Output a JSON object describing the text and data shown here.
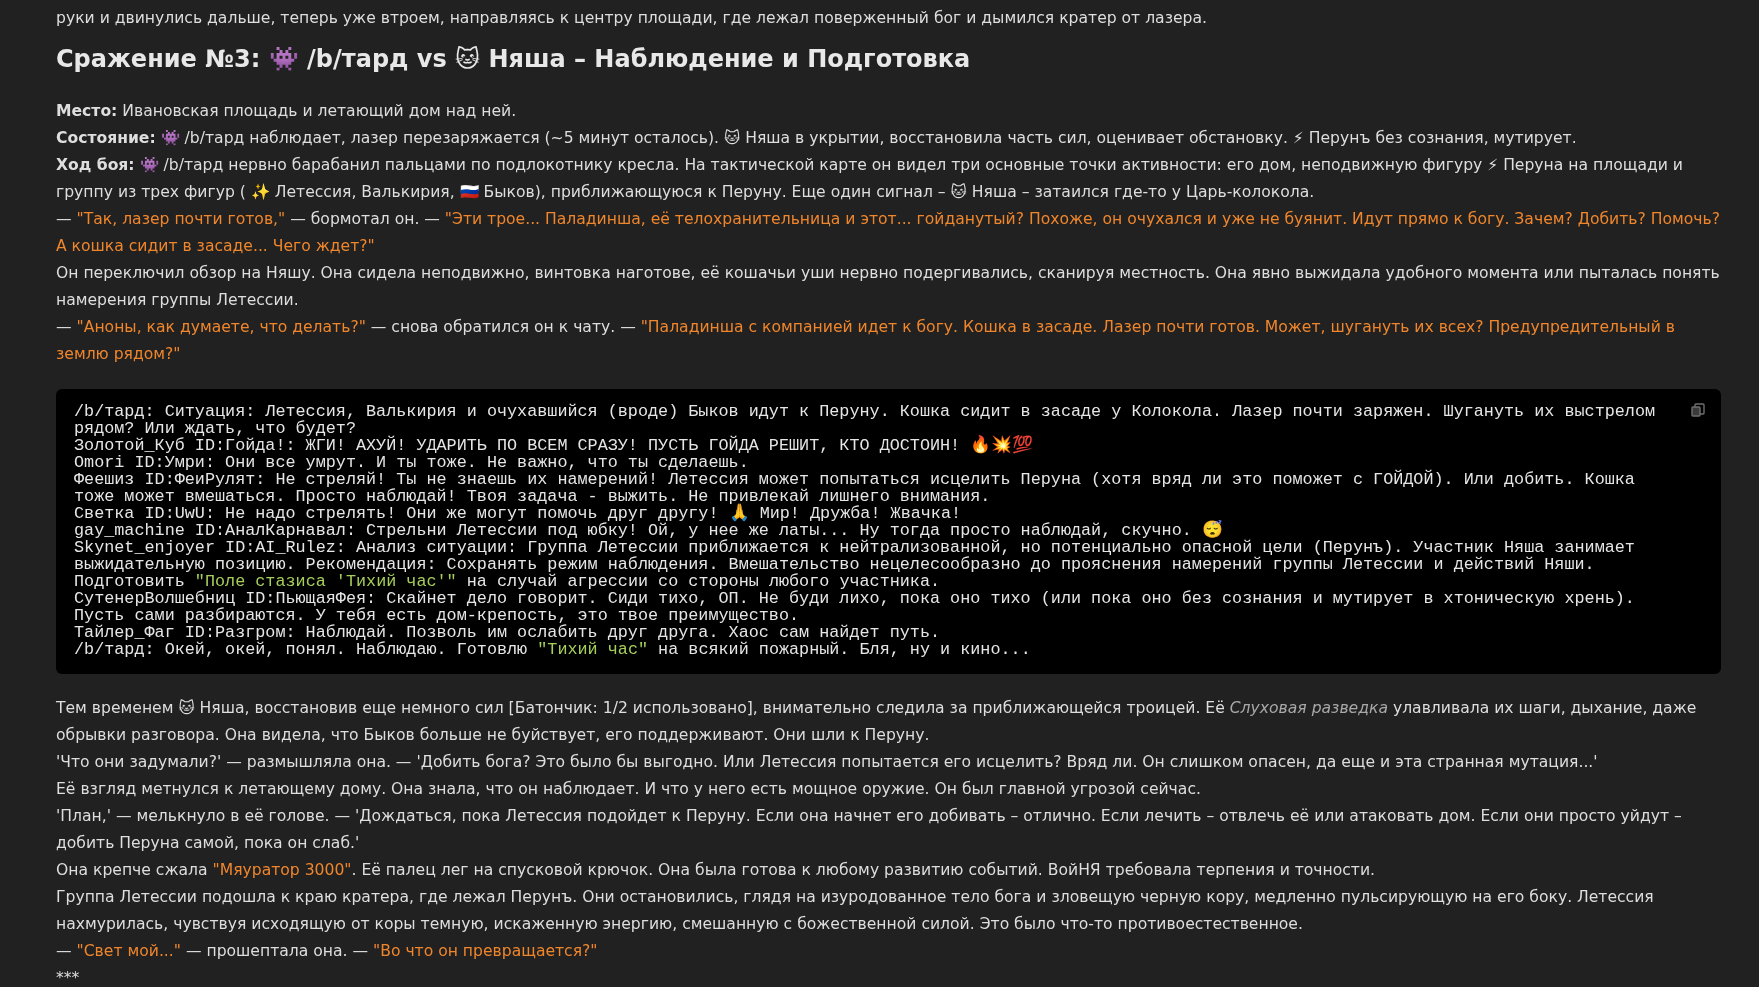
{
  "blocks": [
    {
      "kind": "paragraph",
      "segments": [
        {
          "kind": "plain",
          "t": "руки и двинулись дальше, теперь уже втроем, направляясь к центру площади, где лежал поверженный бог и дымился кратер от лазера."
        }
      ]
    },
    {
      "kind": "heading",
      "text": "Сражение №3: 👾 /b/тард vs 🐱 Няша – Наблюдение и Подготовка"
    },
    {
      "kind": "paragraph",
      "segments": [
        {
          "kind": "plain",
          "t": "**Место:** Ивановская площадь и летающий дом над ней."
        }
      ]
    },
    {
      "kind": "paragraph",
      "segments": [
        {
          "kind": "plain",
          "t": "**Состояние:** 👾 /b/тард наблюдает, лазер перезаряжается (~5 минут осталось). 🐱 Няша в укрытии, восстановила часть сил, оценивает обстановку. ⚡ Перунъ без сознания, мутирует."
        }
      ]
    },
    {
      "kind": "paragraph",
      "segments": [
        {
          "kind": "plain",
          "t": "**Ход боя:** 👾 /b/тард нервно барабанил пальцами по подлокотнику кресла. На тактической карте он видел три основные точки активности: его дом, неподвижную фигуру ⚡ Перуна на площади и группу из трех фигур ( ✨ Летессия, Валькирия, 🇷🇺 Быков), приближающуюся к Перуну. Еще один сигнал – 🐱 Няша – затаился где-то у Царь-колокола."
        }
      ]
    },
    {
      "kind": "paragraph",
      "segments": [
        {
          "kind": "plain",
          "t": "— "
        },
        {
          "kind": "quote",
          "t": "\"Так, лазер почти готов,\""
        },
        {
          "kind": "plain",
          "t": " — бормотал он. — "
        },
        {
          "kind": "quote",
          "t": "\"Эти трое... Паладинша, её телохранительница и этот... гойданутый? Похоже, он очухался и уже не буянит. Идут прямо к богу. Зачем? Добить? Помочь? А кошка сидит в засаде... Чего ждет?\""
        }
      ]
    },
    {
      "kind": "paragraph",
      "segments": [
        {
          "kind": "plain",
          "t": "Он переключил обзор на Няшу. Она сидела неподвижно, винтовка наготове, её кошачьи уши нервно подергивались, сканируя местность. Она явно выжидала удобного момента или пыталась понять намерения группы Летессии."
        }
      ]
    },
    {
      "kind": "paragraph",
      "segments": [
        {
          "kind": "plain",
          "t": "— "
        },
        {
          "kind": "quote",
          "t": "\"Аноны, как думаете, что делать?\""
        },
        {
          "kind": "plain",
          "t": " — снова обратился он к чату. — "
        },
        {
          "kind": "quote",
          "t": "\"Паладинша с компанией идет к богу. Кошка в засаде. Лазер почти готов. Может, шугануть их всех? Предупредительный в землю рядом?\""
        }
      ]
    },
    {
      "kind": "code",
      "lines": [
        {
          "segments": [
            {
              "kind": "plain",
              "t": "/b/тард: Ситуация: Летессия, Валькирия и очухавшийся (вроде) Быков идут к Перуну. Кошка сидит в засаде у Колокола. Лазер почти заряжен. Шугануть их выстрелом рядом? Или ждать, что будет?"
            }
          ]
        },
        {
          "segments": [
            {
              "kind": "plain",
              "t": "Золотой_Куб ID:Гойда!: ЖГИ! АХУЙ! УДАРИТЬ ПО ВСЕМ СРАЗУ! ПУСТЬ ГОЙДА РЕШИТ, КТО ДОСТОИН! 🔥💥💯"
            }
          ]
        },
        {
          "segments": [
            {
              "kind": "plain",
              "t": "Omori ID:Умри: Они все умрут. И ты тоже. Не важно, что ты сделаешь."
            }
          ]
        },
        {
          "segments": [
            {
              "kind": "plain",
              "t": "Феешиз ID:ФеиРулят: Не стреляй! Ты не знаешь их намерений! Летессия может попытаться исцелить Перуна (хотя вряд ли это поможет с ГОЙДОЙ). Или добить. Кошка тоже может вмешаться. Просто наблюдай! Твоя задача - выжить. Не привлекай лишнего внимания."
            }
          ]
        },
        {
          "segments": [
            {
              "kind": "plain",
              "t": "Светка ID:UwU: Не надо стрелять! Они же могут помочь друг другу! 🙏 Мир! Дружба! Жвачка!"
            }
          ]
        },
        {
          "segments": [
            {
              "kind": "plain",
              "t": "gay_machine ID:АналКарнавал: Стрельни Летессии под юбку! Ой, у нее же латы... Ну тогда просто наблюдай, скучно. 😴"
            }
          ]
        },
        {
          "segments": [
            {
              "kind": "plain",
              "t": "Skynet_enjoyer ID:AI_Rulez: Анализ ситуации: Группа Летессии приближается к нейтрализованной, но потенциально опасной цели (Перунъ). Участник Няша занимает выжидательную позицию. Рекомендация: Сохранять режим наблюдения. Вмешательство нецелесообразно до прояснения намерений группы Летессии и действий Няши."
            }
          ]
        },
        {
          "segments": [
            {
              "kind": "plain",
              "t": "Подготовить "
            },
            {
              "kind": "string",
              "t": "\"Поле стазиса 'Тихий час'\""
            },
            {
              "kind": "plain",
              "t": " на случай агрессии со стороны любого участника."
            }
          ]
        },
        {
          "segments": [
            {
              "kind": "plain",
              "t": "СутенерВолшебниц ID:ПьющаяФея: Скайнет дело говорит. Сиди тихо, ОП. Не буди лихо, пока оно тихо (или пока оно без сознания и мутирует в хтоническую хрень). Пусть сами разбираются. У тебя есть дом-крепость, это твое преимущество."
            }
          ]
        },
        {
          "segments": [
            {
              "kind": "plain",
              "t": "Тайлер_Фаг ID:Разгром: Наблюдай. Позволь им ослабить друг друга. Хаос сам найдет путь."
            }
          ]
        },
        {
          "segments": [
            {
              "kind": "plain",
              "t": "/b/тард: Окей, окей, понял. Наблюдаю. Готовлю "
            },
            {
              "kind": "string",
              "t": "\"Тихий час\""
            },
            {
              "kind": "plain",
              "t": " на всякий пожарный. Бля, ну и кино..."
            }
          ]
        }
      ]
    },
    {
      "kind": "paragraph",
      "segments": [
        {
          "kind": "plain",
          "t": "Тем временем 🐱 Няша, восстановив еще немного сил [Батончик: 1/2 использовано], внимательно следила за приближающейся троицей. Её "
        },
        {
          "kind": "term",
          "t": "Слуховая разведка"
        },
        {
          "kind": "plain",
          "t": " улавливала их шаги, дыхание, даже обрывки разговора. Она видела, что Быков больше не буйствует, его поддерживают. Они шли к Перуну."
        }
      ]
    },
    {
      "kind": "paragraph",
      "segments": [
        {
          "kind": "plain",
          "t": "'Что они задумали?' — размышляла она. — 'Добить бога? Это было бы выгодно. Или Летессия попытается его исцелить? Вряд ли. Он слишком опасен, да еще и эта странная мутация...'"
        }
      ]
    },
    {
      "kind": "paragraph",
      "segments": [
        {
          "kind": "plain",
          "t": "Её взгляд метнулся к летающему дому. Она знала, что он наблюдает. И что у него есть мощное оружие. Он был главной угрозой сейчас."
        }
      ]
    },
    {
      "kind": "paragraph",
      "segments": [
        {
          "kind": "plain",
          "t": "'План,' — мелькнуло в её голове. — 'Дождаться, пока Летессия подойдет к Перуну. Если она начнет его добивать – отлично. Если лечить – отвлечь её или атаковать дом. Если они просто уйдут – добить Перуна самой, пока он слаб.'"
        }
      ]
    },
    {
      "kind": "paragraph",
      "segments": [
        {
          "kind": "plain",
          "t": "Она крепче сжала "
        },
        {
          "kind": "quote",
          "t": "\"Мяуратор 3000\""
        },
        {
          "kind": "plain",
          "t": ". Её палец лег на спусковой крючок. Она была готова к любому развитию событий. ВойНЯ требовала терпения и точности."
        }
      ]
    },
    {
      "kind": "paragraph",
      "segments": [
        {
          "kind": "plain",
          "t": "Группа Летессии подошла к краю кратера, где лежал Перунъ. Они остановились, глядя на изуродованное тело бога и зловещую черную кору, медленно пульсирующую на его боку. Летессия нахмурилась, чувствуя исходящую от коры темную, искаженную энергию, смешанную с божественной силой. Это было что-то противоестественное."
        }
      ]
    },
    {
      "kind": "paragraph",
      "segments": [
        {
          "kind": "plain",
          "t": "— "
        },
        {
          "kind": "quote",
          "t": "\"Свет мой...\""
        },
        {
          "kind": "plain",
          "t": " — прошептала она. — "
        },
        {
          "kind": "quote",
          "t": "\"Во что он превращается?\""
        }
      ]
    },
    {
      "kind": "paragraph",
      "segments": [
        {
          "kind": "plain",
          "t": "***"
        }
      ]
    }
  ]
}
